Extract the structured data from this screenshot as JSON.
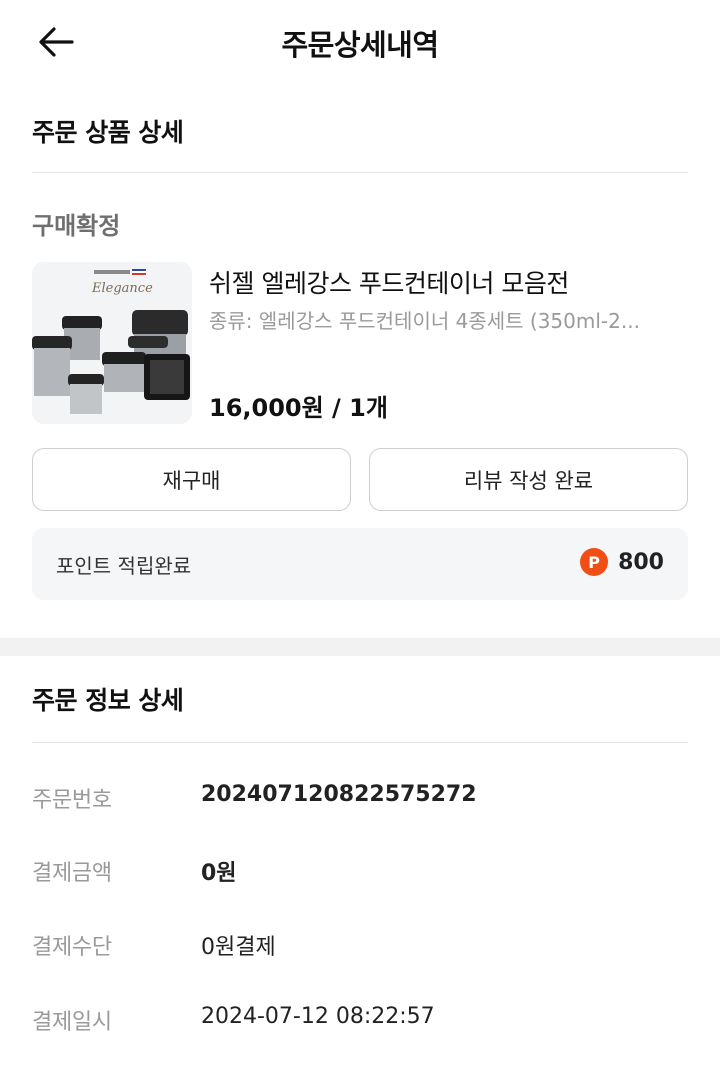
{
  "header": {
    "title": "주문상세내역"
  },
  "product_section": {
    "title": "주문 상품 상세",
    "status": "구매확정",
    "item": {
      "name": "쉬젤 엘레강스 푸드컨테이너 모음전",
      "option": "종류: 엘레강스 푸드컨테이너 4종세트 (350ml-2...",
      "price": "16,000원 / 1개",
      "thumb_brand": "Elegance"
    },
    "buttons": {
      "rebuy": "재구매",
      "review": "리뷰 작성 완료"
    },
    "point": {
      "label": "포인트 적립완료",
      "badge": "P",
      "value": "800"
    }
  },
  "order_info": {
    "title": "주문 정보 상세",
    "rows": [
      {
        "label": "주문번호",
        "value": "20240712082257527​2"
      },
      {
        "label": "결제금액",
        "value": "0원"
      },
      {
        "label": "결제수단",
        "value": "0원결제"
      },
      {
        "label": "결제일시",
        "value": "2024-07-12 08:22:57"
      }
    ]
  },
  "colors": {
    "accent": "#f04e14",
    "muted": "#9a9a9a",
    "divider": "#e6e6e6",
    "card_bg": "#f5f6f8"
  }
}
